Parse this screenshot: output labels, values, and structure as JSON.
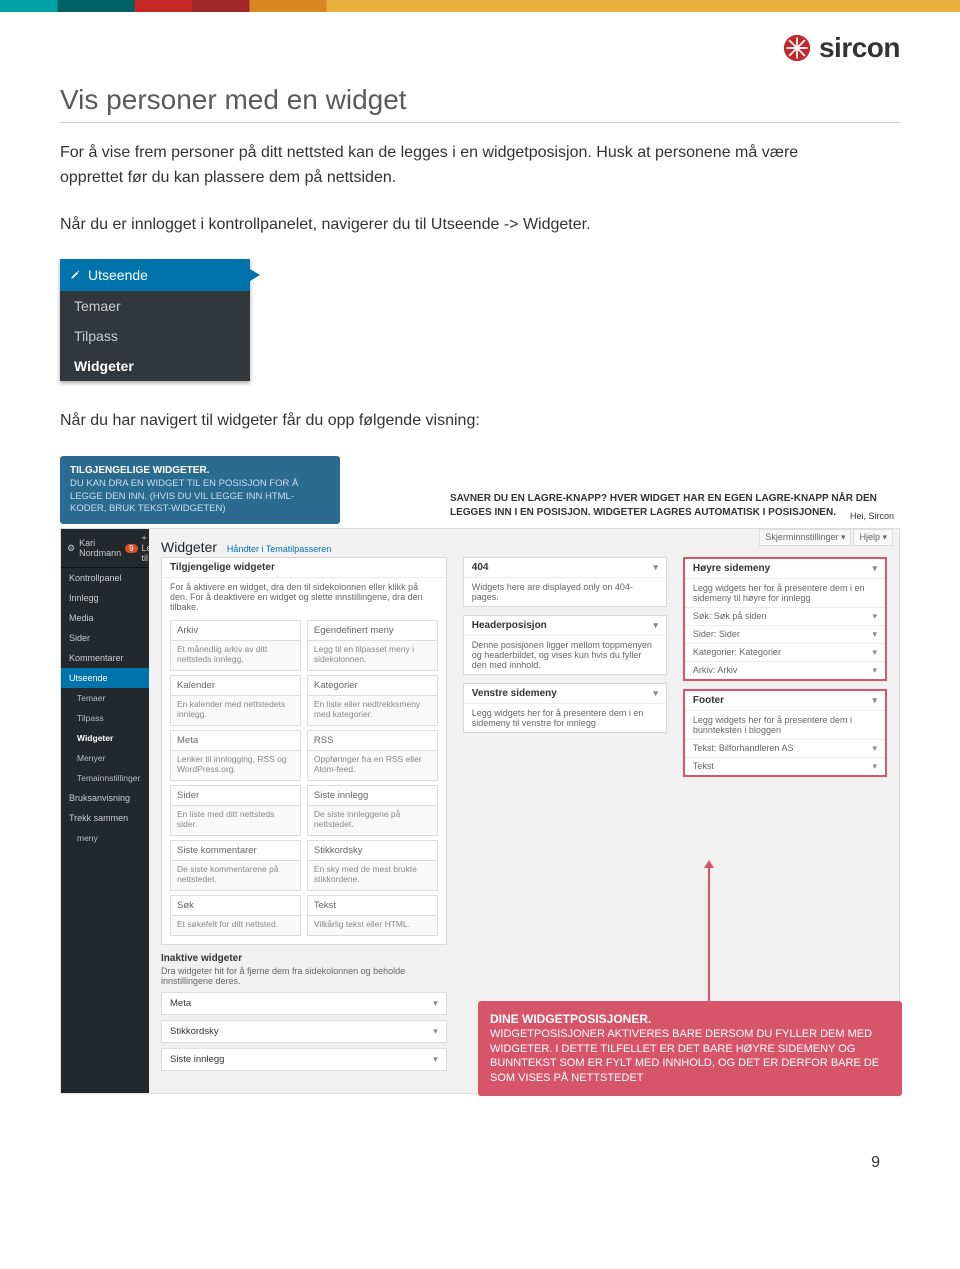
{
  "brand": {
    "name": "sircon"
  },
  "title": "Vis personer med en widget",
  "intro1": "For å vise frem personer på ditt nettsted kan de legges i en widgetposisjon. Husk at personene må være opprettet før du kan plassere dem på nettsiden.",
  "intro2": "Når du er innlogget i kontrollpanelet, navigerer du til Utseende -> Widgeter.",
  "intro3": "Når du har navigert til widgeter får du opp følgende visning:",
  "side_panel": {
    "head_icon": "brush-icon",
    "head": "Utseende",
    "items": [
      "Temaer",
      "Tilpass",
      "Widgeter"
    ],
    "active": "Widgeter"
  },
  "callout_blue": {
    "title": "TILGJENGELIGE WIDGETER.",
    "text": "DU KAN DRA EN WIDGET TIL EN POSISJON FOR Å LEGGE DEN INN. (HVIS DU VIL LEGGE INN HTML-KODER, BRUK TEKST-WIDGETEN)"
  },
  "top_note": "SAVNER DU EN LAGRE-KNAPP? HVER WIDGET HAR EN EGEN LAGRE-KNAPP NÅR DEN LEGGES INN I EN POSISJON. WIDGETER LAGRES AUTOMATISK I POSISJONEN.",
  "wp": {
    "greeting": "Hei, Sircon",
    "tabs": [
      "Skjerminnstillinger ▾",
      "Hjelp ▾"
    ],
    "topbar": {
      "user": "Kari Nordmann",
      "badge": "9",
      "new": "+ Legg til"
    },
    "sidebar": [
      {
        "label": "Kontrollpanel",
        "icon": "dashboard-icon"
      },
      {
        "label": "Innlegg",
        "icon": "pin-icon"
      },
      {
        "label": "Media",
        "icon": "media-icon"
      },
      {
        "label": "Sider",
        "icon": "page-icon"
      },
      {
        "label": "Kommentarer",
        "icon": "comment-icon"
      },
      {
        "label": "Utseende",
        "icon": "brush-icon",
        "active": true
      },
      {
        "label": "Temaer",
        "sub": true
      },
      {
        "label": "Tilpass",
        "sub": true
      },
      {
        "label": "Widgeter",
        "sub": true,
        "on": true
      },
      {
        "label": "Menyer",
        "sub": true
      },
      {
        "label": "Temainnstillinger",
        "sub": true
      },
      {
        "label": "Bruksanvisning",
        "icon": "book-icon"
      },
      {
        "label": "Trekk sammen",
        "icon": "collapse-icon"
      },
      {
        "label": "meny",
        "sub": true
      }
    ],
    "page_title": "Widgeter",
    "page_title_sub": "Håndter i Tematilpasseren",
    "available": {
      "title": "Tilgjengelige widgeter",
      "desc": "For å aktivere en widget, dra den til sidekolonnen eller klikk på den. For å deaktivere en widget og slette innstillingene, dra den tilbake.",
      "widgets": [
        {
          "name": "Arkiv",
          "desc": "Et månedlig arkiv av ditt nettsteds innlegg."
        },
        {
          "name": "Egendefinert meny",
          "desc": "Legg til en tilpasset meny i sidekolonnen."
        },
        {
          "name": "Kalender",
          "desc": "En kalender med nettstedets innlegg."
        },
        {
          "name": "Kategorier",
          "desc": "En liste eller nedtrekksmeny med kategorier."
        },
        {
          "name": "Meta",
          "desc": "Lenker til innlogging, RSS og WordPress.org."
        },
        {
          "name": "RSS",
          "desc": "Oppføringer fra en RSS eller Atom-feed."
        },
        {
          "name": "Sider",
          "desc": "En liste med ditt nettsteds sider."
        },
        {
          "name": "Siste innlegg",
          "desc": "De siste innleggene på nettstedet."
        },
        {
          "name": "Siste kommentarer",
          "desc": "De siste kommentarene på nettstedet."
        },
        {
          "name": "Stikkordsky",
          "desc": "En sky med de mest brukte stikkordene."
        },
        {
          "name": "Søk",
          "desc": "Et søkefelt for ditt nettsted."
        },
        {
          "name": "Tekst",
          "desc": "Vilkårlig tekst eller HTML."
        }
      ]
    },
    "center_panels": [
      {
        "title": "404",
        "desc": "Widgets here are displayed only on 404-pages."
      },
      {
        "title": "Headerposisjon",
        "desc": "Denne posisjonen ligger mellom toppmenyen og headerbildet, og vises kun hvis du fyller den med innhold."
      },
      {
        "title": "Venstre sidemeny",
        "desc": "Legg widgets her for å presentere dem i en sidemeny til venstre for innlegg"
      }
    ],
    "right_panels": [
      {
        "title": "Høyre sidemeny",
        "desc": "Legg widgets her for å presentere dem i en sidemeny til høyre for innlegg",
        "items": [
          "Søk: Søk på siden",
          "Sider: Sider",
          "Kategorier: Kategorier",
          "Arkiv: Arkiv"
        ]
      },
      {
        "title": "Footer",
        "desc": "Legg widgets her for å presentere dem i bunnteksten i bloggen",
        "items": [
          "Tekst: Bilforhandleren AS",
          "Tekst"
        ]
      }
    ],
    "inactive": {
      "title": "Inaktive widgeter",
      "desc": "Dra widgeter hit for å fjerne dem fra sidekolonnen og beholde innstillingene deres.",
      "items": [
        "Meta",
        "Stikkordsky",
        "Siste innlegg"
      ]
    }
  },
  "callout_red": {
    "title": "DINE WIDGETPOSISJONER.",
    "text": "WIDGETPOSISJONER AKTIVERES BARE DERSOM DU FYLLER DEM MED WIDGETER. I DETTE TILFELLET ER DET BARE HØYRE SIDEMENY OG BUNNTEKST SOM ER FYLT MED INNHOLD, OG DET ER DERFOR BARE DE SOM VISES PÅ NETTSTEDET"
  },
  "page_number": "9"
}
